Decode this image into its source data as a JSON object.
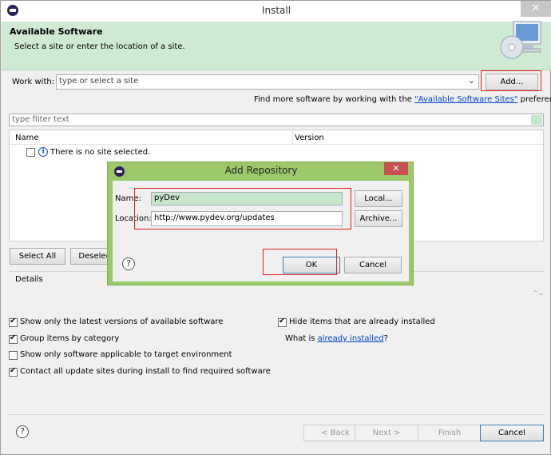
{
  "window": {
    "title": "Install",
    "close_glyph": "✕"
  },
  "banner": {
    "heading": "Available Software",
    "subtitle": "Select a site or enter the location of a site."
  },
  "work_with": {
    "label": "Work with:",
    "placeholder": "type or select a site",
    "dropdown_glyph": "⌄",
    "add_button": "Add..."
  },
  "find_more": {
    "prefix": "Find more software by working with the ",
    "link": "\"Available Software Sites\"",
    "suffix": " preferences."
  },
  "filter": {
    "placeholder": "type filter text"
  },
  "tree": {
    "col_name": "Name",
    "col_version": "Version",
    "info_glyph": "i",
    "empty_message": "There is no site selected."
  },
  "buttons": {
    "select_all": "Select All",
    "deselect_all": "Deselect All"
  },
  "details": {
    "label": "Details",
    "scroll_glyph": "⌃⌄"
  },
  "options": [
    {
      "label": "Show only the latest versions of available software",
      "checked": true
    },
    {
      "label": "Group items by category",
      "checked": true
    },
    {
      "label": "Show only software applicable to target environment",
      "checked": false
    },
    {
      "label": "Contact all update sites during install to find required software",
      "checked": true
    },
    {
      "label": "Hide items that are already installed",
      "checked": true
    }
  ],
  "what_is": {
    "prefix": "What is ",
    "link": "already installed",
    "suffix": "?"
  },
  "footer": {
    "help_glyph": "?",
    "back": "< Back",
    "next": "Next >",
    "finish": "Finish",
    "cancel": "Cancel"
  },
  "dialog": {
    "title": "Add Repository",
    "close_glyph": "✕",
    "name_label": "Name:",
    "name_value": "pyDev",
    "local_button": "Local...",
    "location_label": "Location:",
    "location_value": "http://www.pydev.org/updates",
    "archive_button": "Archive...",
    "help_glyph": "?",
    "ok": "OK",
    "cancel": "Cancel"
  },
  "colors": {
    "banner": "#cfe9d2",
    "dialog_frame": "#9cc86a",
    "highlight": "#e02020",
    "link": "#0044cc",
    "name_field": "#c8e6cc"
  }
}
